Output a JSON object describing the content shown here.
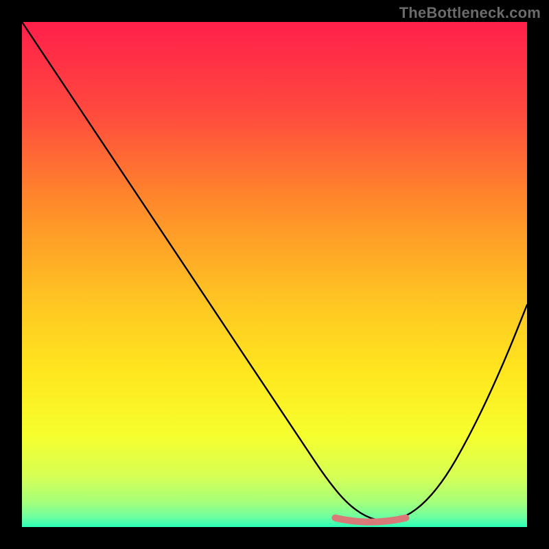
{
  "watermark": "TheBottleneck.com",
  "gradient_stops": [
    {
      "offset": 0.0,
      "color": "#ff1f4b"
    },
    {
      "offset": 0.18,
      "color": "#ff4a3e"
    },
    {
      "offset": 0.36,
      "color": "#ff8a2a"
    },
    {
      "offset": 0.54,
      "color": "#ffc223"
    },
    {
      "offset": 0.7,
      "color": "#ffe81f"
    },
    {
      "offset": 0.82,
      "color": "#f6ff2e"
    },
    {
      "offset": 0.9,
      "color": "#d6ff55"
    },
    {
      "offset": 0.95,
      "color": "#a6ff7a"
    },
    {
      "offset": 0.98,
      "color": "#6effa0"
    },
    {
      "offset": 1.0,
      "color": "#2bffb8"
    }
  ],
  "chart_data": {
    "type": "line",
    "title": "",
    "xlabel": "",
    "ylabel": "",
    "xlim": [
      0,
      100
    ],
    "ylim": [
      0,
      100
    ],
    "series": [
      {
        "name": "bottleneck-curve",
        "x": [
          0,
          8,
          16,
          24,
          32,
          40,
          48,
          56,
          60,
          64,
          68,
          72,
          76,
          80,
          84,
          88,
          92,
          96,
          100
        ],
        "values": [
          100,
          88,
          76,
          64,
          52,
          40,
          28,
          16,
          10,
          5,
          2,
          1,
          2,
          5,
          10,
          17,
          25,
          34,
          44
        ]
      }
    ],
    "annotations": [
      {
        "name": "valley-marker",
        "x_range": [
          62,
          76
        ],
        "y": 1
      }
    ]
  },
  "curve_style": {
    "stroke": "#000000",
    "width": 2.4
  },
  "valley_style": {
    "stroke": "#d97a78",
    "width": 10
  }
}
